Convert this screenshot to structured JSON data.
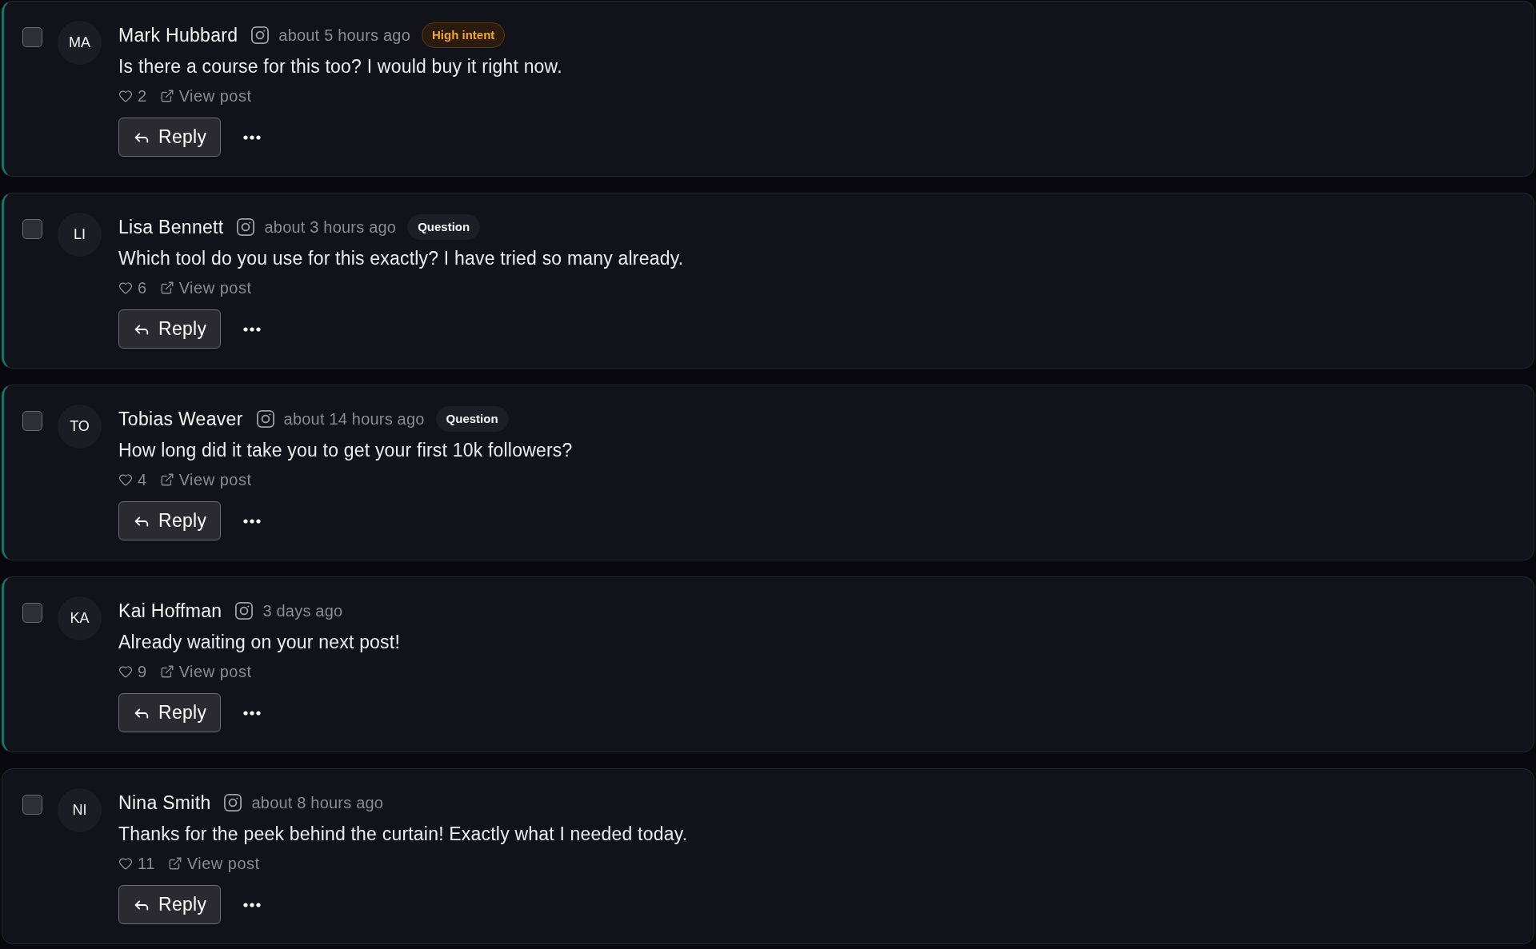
{
  "comments": [
    {
      "checked": false,
      "unread": true,
      "initials": "MA",
      "name": "Mark Hubbard",
      "time": "about 5 hours ago",
      "tag": {
        "kind": "high_intent",
        "label": "High intent"
      },
      "text": "Is there a course for this too? I would buy it right now.",
      "likes": "2",
      "link": "View post",
      "reply": "Reply"
    },
    {
      "checked": false,
      "unread": true,
      "initials": "LI",
      "name": "Lisa Bennett",
      "time": "about 3 hours ago",
      "tag": {
        "kind": "question",
        "label": "Question"
      },
      "text": "Which tool do you use for this exactly? I have tried so many already.",
      "likes": "6",
      "link": "View post",
      "reply": "Reply"
    },
    {
      "checked": false,
      "unread": true,
      "initials": "TO",
      "name": "Tobias Weaver",
      "time": "about 14 hours ago",
      "tag": {
        "kind": "question",
        "label": "Question"
      },
      "text": "How long did it take you to get your first 10k followers?",
      "likes": "4",
      "link": "View post",
      "reply": "Reply"
    },
    {
      "checked": false,
      "unread": true,
      "initials": "KA",
      "name": "Kai Hoffman",
      "time": "3 days ago",
      "text": "Already waiting on your next post!",
      "likes": "9",
      "link": "View post",
      "reply": "Reply"
    },
    {
      "checked": false,
      "unread": false,
      "initials": "NI",
      "name": "Nina Smith",
      "time": "about 8 hours ago",
      "text": "Thanks for the peek behind the curtain! Exactly what I needed today.",
      "likes": "11",
      "link": "View post",
      "reply": "Reply"
    }
  ]
}
